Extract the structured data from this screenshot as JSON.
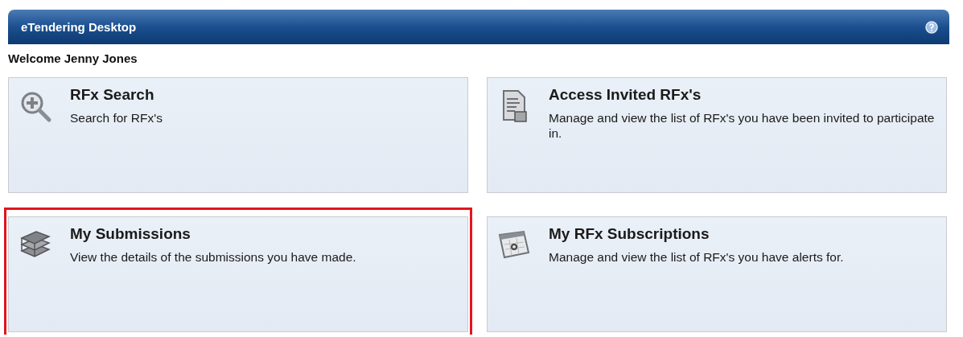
{
  "header": {
    "title": "eTendering Desktop"
  },
  "welcome": "Welcome Jenny Jones",
  "tiles": [
    {
      "kind": "search",
      "title": "RFx Search",
      "description": "Search for RFx's",
      "highlighted": false
    },
    {
      "kind": "document",
      "title": "Access Invited RFx's",
      "description": "Manage and view the list of RFx's you have been invited to participate in.",
      "highlighted": false
    },
    {
      "kind": "books",
      "title": "My Submissions",
      "description": "View the details of the submissions you have made.",
      "highlighted": true
    },
    {
      "kind": "calendar",
      "title": "My RFx Subscriptions",
      "description": "Manage and view the list of RFx's you have alerts for.",
      "highlighted": false
    }
  ]
}
